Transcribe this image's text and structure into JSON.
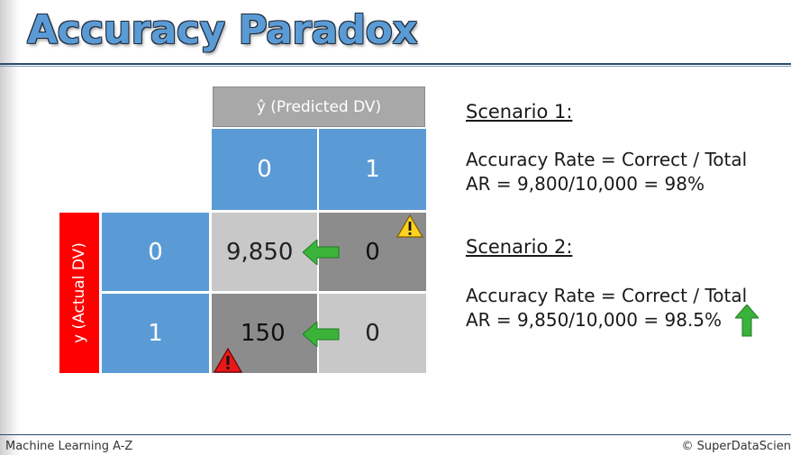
{
  "slide": {
    "title": "Accuracy Paradox"
  },
  "matrix": {
    "predicted_header": "ŷ (Predicted DV)",
    "actual_header": "y (Actual DV)",
    "col_labels": [
      "0",
      "1"
    ],
    "row_labels": [
      "0",
      "1"
    ],
    "cells": [
      [
        "9,850",
        "0"
      ],
      [
        "150",
        "0"
      ]
    ]
  },
  "scenarios": [
    {
      "heading": "Scenario 1:",
      "lines": [
        "Accuracy Rate = Correct / Total",
        "AR = 9,800/10,000 = 98%"
      ]
    },
    {
      "heading": "Scenario 2:",
      "lines": [
        "Accuracy Rate = Correct / Total",
        "AR = 9,850/10,000 = 98.5%"
      ]
    }
  ],
  "icons": {
    "warning_yellow": "warning-yellow-icon",
    "warning_red": "warning-red-icon",
    "arrow_left": "arrow-left-icon",
    "arrow_up": "arrow-up-icon"
  },
  "colors": {
    "accent_blue": "#5b9bd5",
    "header_gray": "#a8a8a8",
    "actual_red": "#ff0000",
    "arrow_green": "#3bb33b"
  },
  "footer": {
    "left": "Machine Learning A-Z",
    "right": "© SuperDataScien"
  }
}
